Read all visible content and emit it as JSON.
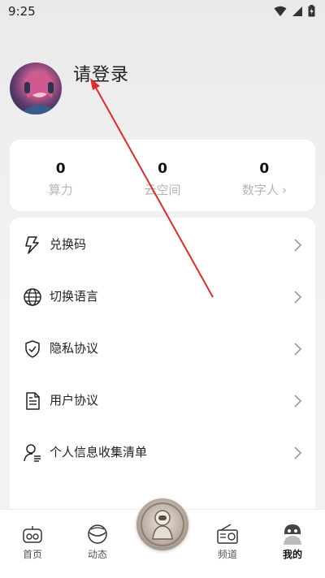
{
  "status": {
    "time": "9:25"
  },
  "profile": {
    "login_text": "请登录"
  },
  "stats": [
    {
      "value": "0",
      "label": "算力"
    },
    {
      "value": "0",
      "label": "云空间"
    },
    {
      "value": "0",
      "label": "数字人"
    }
  ],
  "menu": [
    {
      "label": "兑换码",
      "icon": "lightning-icon"
    },
    {
      "label": "切换语言",
      "icon": "globe-icon"
    },
    {
      "label": "隐私协议",
      "icon": "shield-check-icon"
    },
    {
      "label": "用户协议",
      "icon": "document-icon"
    },
    {
      "label": "个人信息收集清单",
      "icon": "user-list-icon"
    }
  ],
  "nav": [
    {
      "label": "首页",
      "icon": "home-icon"
    },
    {
      "label": "动态",
      "icon": "planet-icon"
    },
    {
      "label": "频道",
      "icon": "radio-icon"
    },
    {
      "label": "我的",
      "icon": "profile-icon",
      "active": true
    }
  ],
  "colors": {
    "annotation_arrow": "#e02b2b",
    "label_gray": "#b5b5b5"
  }
}
